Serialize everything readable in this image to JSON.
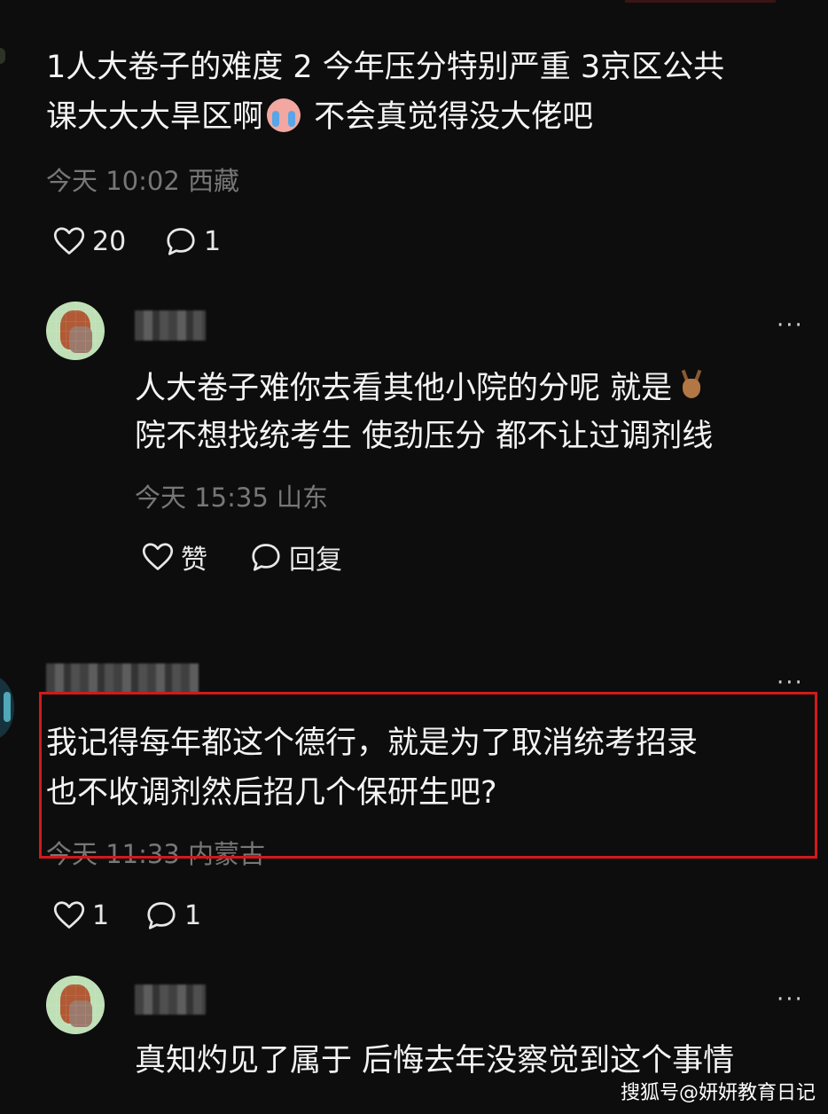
{
  "post": {
    "body_line1": "1人大卷子的难度 2 今年压分特别严重 3京区公共",
    "body_line2a": "课大大大旱区啊",
    "body_line2_emoji": "crying-face-emoji",
    "body_line2b": " 不会真觉得没大佬吧",
    "meta": "今天 10:02 西藏",
    "likes": "20",
    "comments": "1"
  },
  "reply1": {
    "more": "···",
    "body_line1": "人大卷子难你去看其他小院的分呢 就是",
    "body_line1_emoji": "deer-emoji",
    "body_line2": "院不想找统考生 使劲压分 都不让过调剂线",
    "meta": "今天 15:35 山东",
    "like_label": "赞",
    "reply_label": "回复"
  },
  "comment2": {
    "more": "···",
    "body_line1": "我记得每年都这个德行，就是为了取消统考招录",
    "body_line2": "也不收调剂然后招几个保研生吧?",
    "meta": "今天 11:33 内蒙古",
    "likes": "1",
    "comments": "1",
    "highlight_color": "#d01a1a"
  },
  "reply2": {
    "more": "···",
    "body_line1": "真知灼见了属于 后悔去年没察觉到这个事情"
  },
  "watermark": "搜狐号@妍妍教育日记",
  "icons": {
    "like": "heart-outline-icon",
    "comment": "speech-bubble-icon",
    "more": "more-dots-icon"
  }
}
